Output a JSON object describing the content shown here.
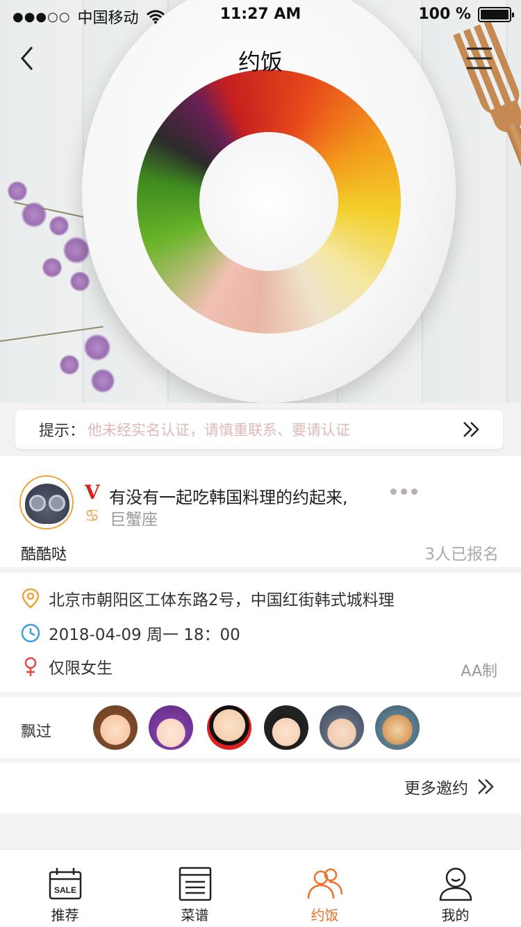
{
  "status_bar": {
    "signal": "●●●○○",
    "carrier": "中国移动",
    "time": "11:27 AM",
    "battery": "100 %"
  },
  "nav": {
    "title": "约饭"
  },
  "tip": {
    "label": "提示：",
    "text": "他未经实名认证，请慎重联系、要请认证"
  },
  "post": {
    "badge": "V",
    "title": "有没有一起吃韩国料理的约起来,",
    "zodiac_symbol": "♋",
    "zodiac": "巨蟹座",
    "username": "酷酷哒",
    "signup_count": "3人已报名"
  },
  "details": {
    "address": "北京市朝阳区工体东路2号，中国红街韩式城料理",
    "datetime": "2018-04-09 周一 18：00",
    "gender_limit": "仅限女生",
    "payment": "AA制"
  },
  "visited": {
    "label": "飘过",
    "count_shown": 6
  },
  "more_invite": {
    "label": "更多邀约"
  },
  "tabs": [
    {
      "label": "推荐",
      "icon": "calendar-sale-icon",
      "badge": "SALE"
    },
    {
      "label": "菜谱",
      "icon": "recipe-list-icon"
    },
    {
      "label": "约饭",
      "icon": "people-icon",
      "active": true
    },
    {
      "label": "我的",
      "icon": "profile-icon"
    }
  ],
  "colors": {
    "accent": "#f1702a",
    "warning_text": "#e0b8b8",
    "verified_red": "#d92020",
    "avatar_ring": "#f0a13a",
    "clock_blue": "#3a9de0",
    "female_red": "#e04848"
  }
}
